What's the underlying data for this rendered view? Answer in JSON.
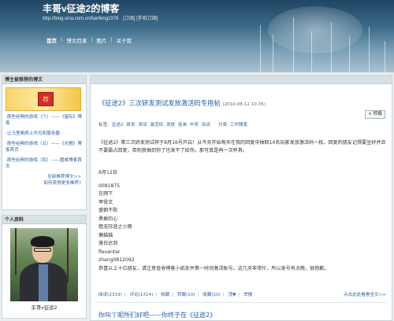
{
  "header": {
    "blog_title": "丰哥v征途2的博客",
    "blog_url": "http://blog.sina.com.cn/tianfeng1979",
    "subscribe_label": "[订阅]",
    "mobile_subscribe_label": "[手机订阅]",
    "nav": [
      "首页",
      "博文目录",
      "图片",
      "关于我"
    ]
  },
  "recommend": {
    "title": "博主被推荐的博文",
    "items": [
      "·那些经典的游戏（六）——《星际》博客",
      "·让马里奥爬上坏月和服务器",
      "·那些经典的游戏（五）——《光棍》博客首页",
      "·那些经典的游戏（四）——圆威博客首页"
    ],
    "more": [
      "全部推荐博文>>",
      "如何获得更多推荐?"
    ]
  },
  "profile": {
    "title": "个人资料",
    "name": "丰哥v征途2"
  },
  "post": {
    "title": "《征途2》三次研发测试发放激活码专用帖",
    "date": "(2010-08-12 10:35)",
    "reprint_label": "转载",
    "tags_label": "标签:",
    "tags": [
      "征途2",
      "研发",
      "测试",
      "激活码",
      "发放",
      "徒弟",
      "中奖",
      "杂谈"
    ],
    "category_label": "分类:",
    "category": "工作随笔",
    "intro": "《征途2》第三次研发测试将于8月16号开启！从今天开始每天在我的回复中抽取10名玩家发放激活码一枚。回复的朋友记得要坐好并且不要霸占回复，否则我抽到你了也发不了给你。那可真是再一次杯具。",
    "lines": [
      "8月12日",
      "0081875",
      "在网下",
      "甲骨文",
      "盛朝不败",
      "勇敢的心",
      "樯无际涯之小雨",
      "懒猫猫",
      "落日达到",
      "fleventer",
      "zhang0812092",
      "恭喜以上十位朋友，请注意查收博客小纸条并第一时间激活账号。这几天非常忙，所以发号有点晚，很抱歉。"
    ],
    "footer": [
      "阅读(2319)",
      "评论(1314)",
      "收藏",
      "转载(10)",
      "收藏(10)",
      "顶▼",
      "举报"
    ],
    "footer_more": "点击此处看看全文>>",
    "next_title": "你叫丫呢所们好吧——你终于在《征途2》"
  }
}
